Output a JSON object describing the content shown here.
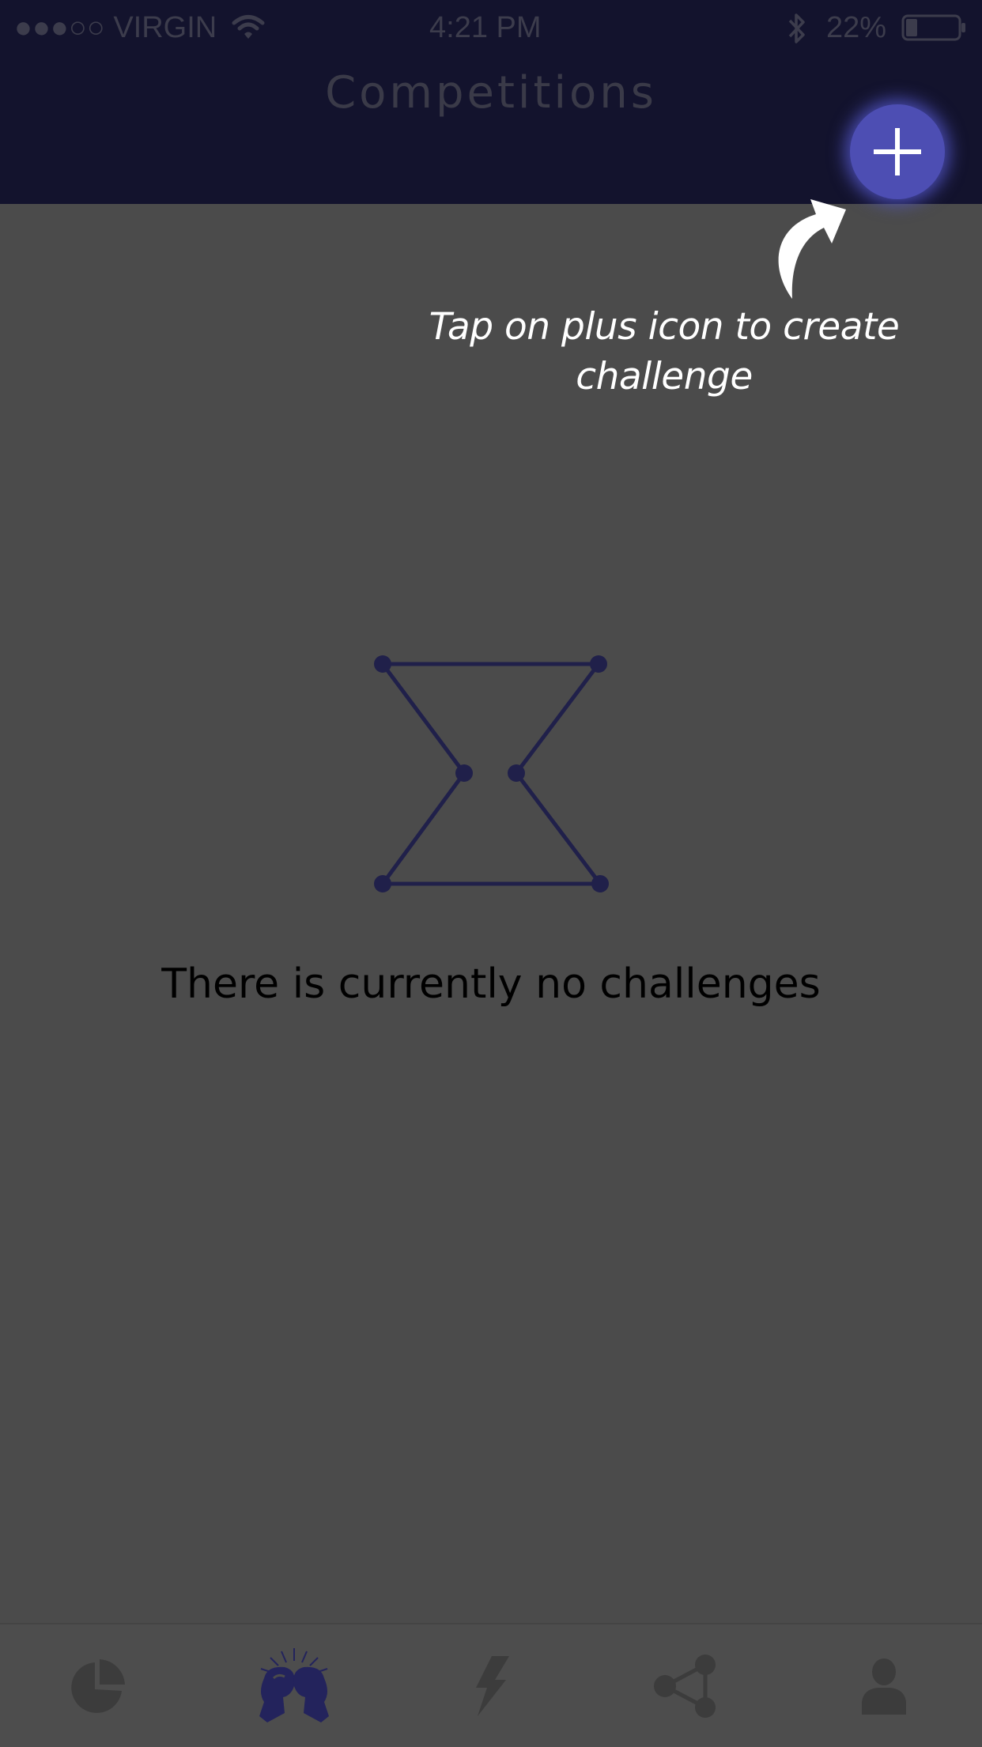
{
  "status_bar": {
    "carrier": "●●●○○ VIRGIN",
    "time": "4:21 PM",
    "battery": "22%",
    "battery_level": 0.22,
    "icons": [
      "signal-dots",
      "wifi-icon",
      "bluetooth-icon",
      "battery-icon"
    ]
  },
  "header": {
    "title": "Competitions",
    "add_icon": "plus-icon",
    "background_color": "#13132d",
    "accent_color": "#4d4eb3"
  },
  "hint": {
    "text": "Tap on plus icon to create challenge",
    "icon": "curved-arrow-icon"
  },
  "empty_state": {
    "icon": "hourglass-icon",
    "message": "There is currently no challenges"
  },
  "tab_bar": {
    "tabs": [
      {
        "icon": "pie-chart-icon",
        "active": false
      },
      {
        "icon": "boxing-gloves-icon",
        "active": true
      },
      {
        "icon": "lightning-icon",
        "active": false
      },
      {
        "icon": "share-icon",
        "active": false
      },
      {
        "icon": "person-icon",
        "active": false
      }
    ],
    "active_color": "#23235c",
    "inactive_color": "#3c3c3c"
  }
}
